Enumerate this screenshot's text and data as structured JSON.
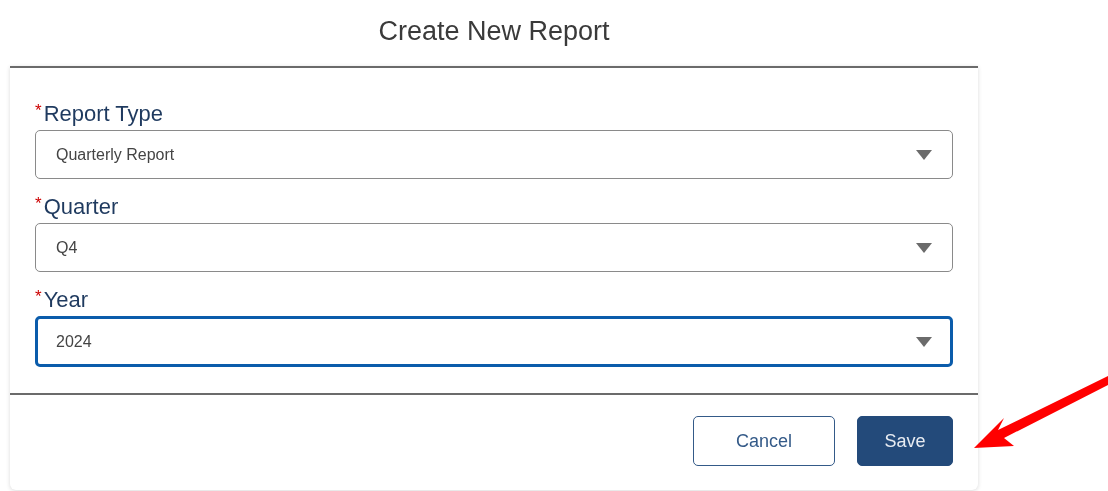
{
  "dialog": {
    "title": "Create New Report",
    "fields": [
      {
        "label": "Report Type",
        "required_mark": "*",
        "value": "Quarterly Report",
        "focused": false
      },
      {
        "label": "Quarter",
        "required_mark": "*",
        "value": "Q4",
        "focused": false
      },
      {
        "label": "Year",
        "required_mark": "*",
        "value": "2024",
        "focused": true
      }
    ],
    "buttons": [
      {
        "label": "Cancel",
        "kind": "secondary"
      },
      {
        "label": "Save",
        "kind": "primary"
      }
    ]
  }
}
